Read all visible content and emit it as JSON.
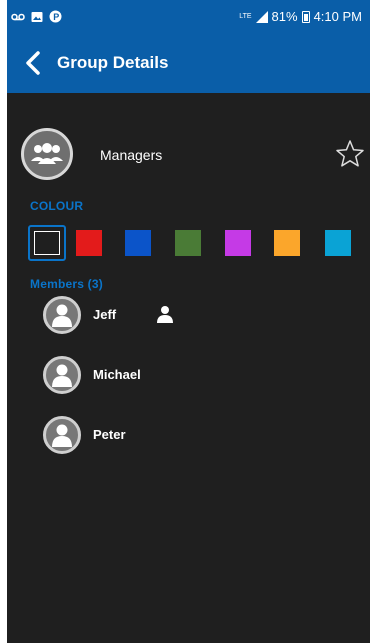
{
  "status_bar": {
    "network": "LTE",
    "battery": "81%",
    "time": "4:10 PM",
    "icons": [
      "voicemail-icon",
      "image-icon",
      "parking-app-icon",
      "signal-icon",
      "battery-icon"
    ]
  },
  "header": {
    "title": "Group Details",
    "back_icon": "back-arrow-icon"
  },
  "group": {
    "name": "Managers",
    "favorite": false
  },
  "colour": {
    "label": "COLOUR",
    "swatches": [
      "#1f1f1f",
      "#e31b1b",
      "#0b54c9",
      "#4a7b36",
      "#c53ae6",
      "#fba62b",
      "#0aa3d5"
    ],
    "selected_index": 0
  },
  "members": {
    "label": "Members (3)",
    "items": [
      {
        "name": "Jeff",
        "is_admin": true
      },
      {
        "name": "Michael",
        "is_admin": false
      },
      {
        "name": "Peter",
        "is_admin": false
      }
    ]
  },
  "colors": {
    "accent": "#0a5ea8",
    "section_label": "#0a74c9",
    "background": "#1f1f1f"
  }
}
